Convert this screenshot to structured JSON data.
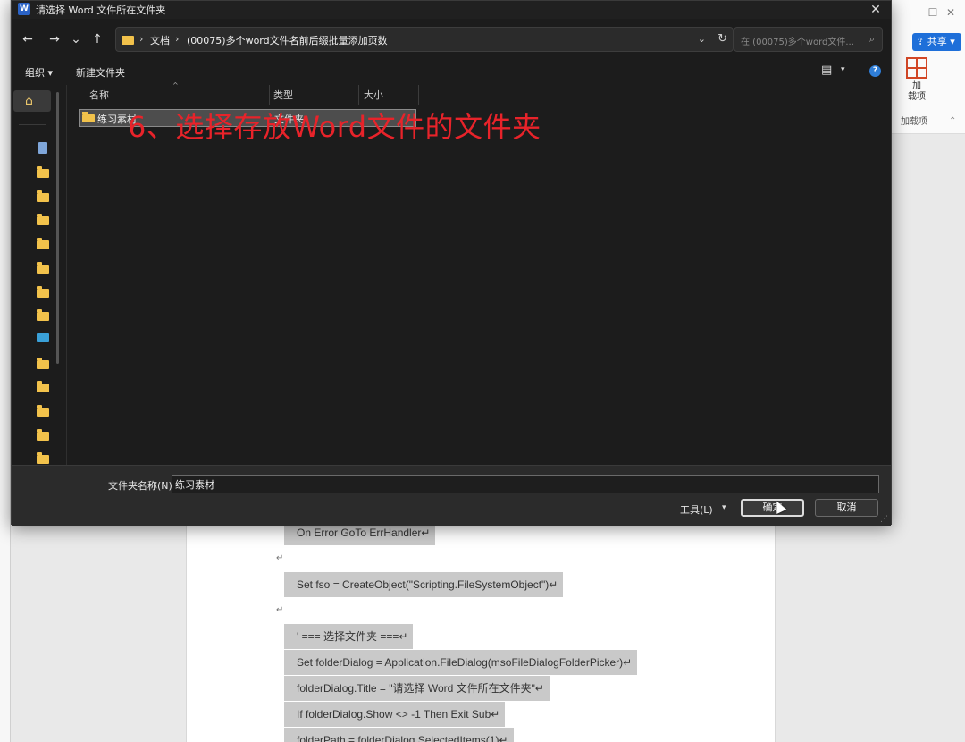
{
  "word": {
    "window_controls": [
      "—",
      "☐",
      "✕"
    ],
    "share_label": "共享",
    "addins_label": "加载项",
    "addins_button_label": "加\n载项",
    "code_lines": [
      "On Error GoTo ErrHandler↵",
      "Set fso = CreateObject(\"Scripting.FileSystemObject\")↵",
      "' ===  选择文件夹  ===↵",
      "Set folderDialog = Application.FileDialog(msoFileDialogFolderPicker)↵",
      "folderDialog.Title = \"请选择  Word  文件所在文件夹\"↵",
      "If folderDialog.Show <> -1 Then Exit Sub↵",
      "folderPath = folderDialog.SelectedItems(1)↵"
    ],
    "paragraph_mark": "↵"
  },
  "dialog": {
    "title": "请选择 Word 文件所在文件夹",
    "app_icon_letter": "W",
    "close": "✕",
    "nav": {
      "back": "←",
      "forward": "→",
      "recent": "⌄",
      "up": "↑"
    },
    "breadcrumb": [
      "文档",
      "(00075)多个word文件名前后缀批量添加页数"
    ],
    "breadcrumb_sep": "›",
    "address_dropdown": "⌄",
    "refresh": "↻",
    "search_placeholder": "在 (00075)多个word文件...",
    "search_icon": "⌕",
    "toolbar": {
      "organize": "组织 ▾",
      "new_folder": "新建文件夹",
      "view": "▤",
      "view_dd": "▾",
      "help": "?"
    },
    "columns": [
      "名称",
      "类型",
      "大小"
    ],
    "sort_arrow": "^",
    "files": [
      {
        "name": "练习素材",
        "type": "文件夹",
        "selected": true
      }
    ],
    "overlay_caption": "6、选择存放Word文件的文件夹",
    "folder_name_label": "文件夹名称(N):",
    "folder_name_value": "练习素材",
    "tools_label": "工具(L)",
    "tools_dd": "▾",
    "ok_label": "确定",
    "cancel_label": "取消",
    "resize_grip": "⋰",
    "home_icon": "⌂"
  },
  "colors": {
    "dialog_bg": "#1c1c1c",
    "caption_red": "#e8232a",
    "folder_yellow": "#f2c24b",
    "share_blue": "#1e6fd9"
  }
}
